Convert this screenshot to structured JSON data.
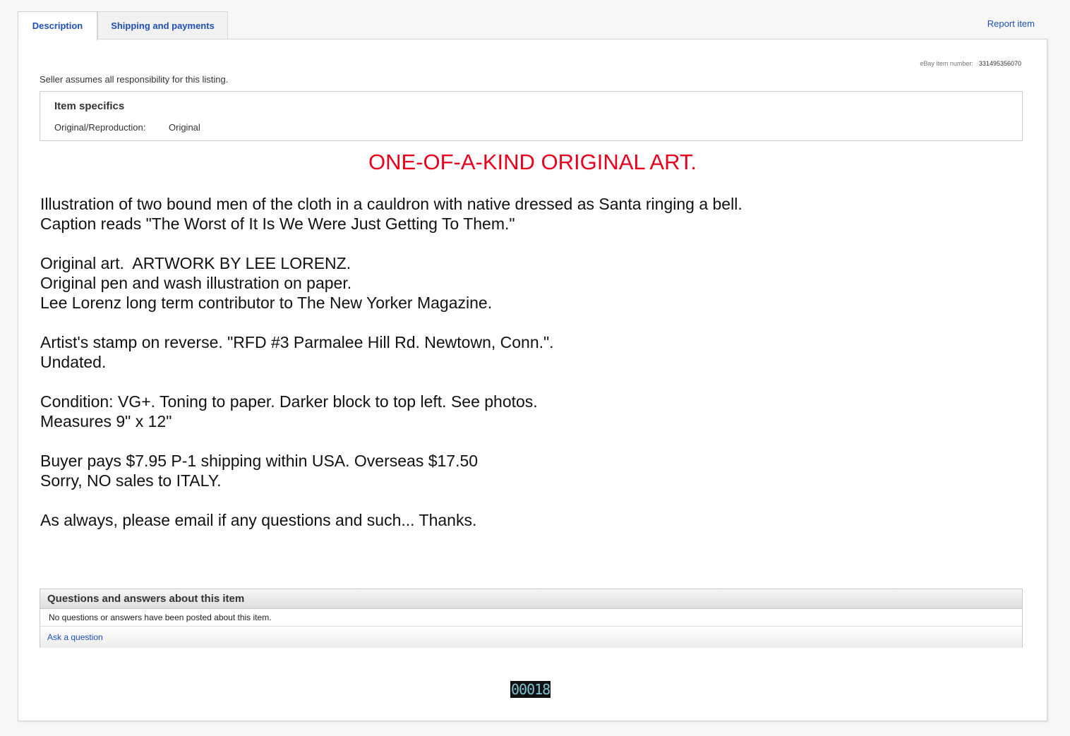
{
  "tabs": {
    "description": "Description",
    "shipping": "Shipping and payments"
  },
  "report_item": "Report item",
  "item_number": {
    "label": "eBay item number:",
    "value": "331495356070"
  },
  "responsibility": "Seller assumes all responsibility for this listing.",
  "specifics": {
    "title": "Item specifics",
    "label": "Original/Reproduction:",
    "value": "Original"
  },
  "headline": "ONE-OF-A-KIND ORIGINAL ART.",
  "description": {
    "line1": "Illustration of two bound men of the cloth in a cauldron with native dressed as Santa ringing a bell.",
    "line2": "Caption reads \"The Worst of It Is We Were Just Getting To Them.\"",
    "line3": "Original art.  ARTWORK BY LEE LORENZ.",
    "line4": "Original pen and wash illustration on paper.",
    "line5": "Lee Lorenz long term contributor to The New Yorker Magazine.",
    "line6": "Artist's stamp on reverse. \"RFD #3 Parmalee Hill Rd. Newtown, Conn.\".",
    "line7": "Undated.",
    "line8": "Condition: VG+. Toning to paper. Darker block to top left. See photos.",
    "line9": "Measures 9\" x 12\"",
    "line10": "Buyer pays $7.95 P-1 shipping within USA. Overseas $17.50",
    "line11": "Sorry, NO sales to ITALY.",
    "line12": "As always, please email if any questions and such... Thanks."
  },
  "qa": {
    "title": "Questions and answers about this item",
    "empty": "No questions or answers have been posted about this item.",
    "ask": "Ask a question"
  },
  "counter": "00018",
  "colors": {
    "link": "#1e4fb4",
    "headline": "#e8001c"
  }
}
